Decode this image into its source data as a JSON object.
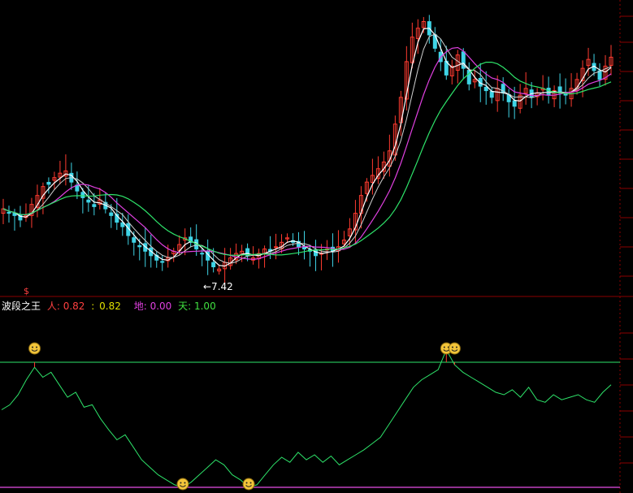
{
  "colors": {
    "background": "#000000",
    "up_candle": "#ff3b30",
    "down_candle": "#3fd4e6",
    "ma_white": "#ffffff",
    "ma_magenta": "#e040e0",
    "ma_green": "#2ee36a",
    "osc_line": "#2ee36a",
    "upper_level": "#2ee36a",
    "lower_level": "#c040c0",
    "grid": "#8b0000",
    "text_white": "#ffffff",
    "text_red": "#ff4040",
    "text_magenta": "#e040e0",
    "text_green": "#40e040"
  },
  "main_chart": {
    "low_annotation": "←7.42",
    "marker_top": "$"
  },
  "indicator": {
    "title": "波段之王",
    "ren_label": "人:",
    "ren_value": "0.82",
    "ren_sep": ":",
    "ren_value2": "0.82",
    "di_label": "地:",
    "di_value": "0.00",
    "tian_label": "天:",
    "tian_value": "1.00",
    "top_icon": "smiley-icon",
    "bottom_icon": "smiley-icon"
  },
  "chart_data": [
    {
      "type": "candlestick",
      "title": "",
      "annotations": [
        "←7.42"
      ],
      "close": [
        10.2,
        10.0,
        9.9,
        9.7,
        9.9,
        10.4,
        10.8,
        11.2,
        11.3,
        11.6,
        11.8,
        11.9,
        11.4,
        11.0,
        10.7,
        10.5,
        10.3,
        10.6,
        10.2,
        9.9,
        9.6,
        9.4,
        9.0,
        8.7,
        8.5,
        8.3,
        8.1,
        7.9,
        7.8,
        8.0,
        8.3,
        8.6,
        8.9,
        8.7,
        8.4,
        8.2,
        7.9,
        7.6,
        7.5,
        7.8,
        8.0,
        8.2,
        8.3,
        8.1,
        8.0,
        8.2,
        8.4,
        8.3,
        8.5,
        8.7,
        8.9,
        8.7,
        8.5,
        8.4,
        8.3,
        8.1,
        8.2,
        8.4,
        8.3,
        8.5,
        8.8,
        9.3,
        10.0,
        10.8,
        11.4,
        11.7,
        12.0,
        12.3,
        12.8,
        14.0,
        15.2,
        16.8,
        17.9,
        18.3,
        18.6,
        18.0,
        17.4,
        16.8,
        16.2,
        16.6,
        17.1,
        16.5,
        15.8,
        16.0,
        15.7,
        15.5,
        15.2,
        15.6,
        15.4,
        15.0,
        14.8,
        15.3,
        15.6,
        15.2,
        15.4,
        15.6,
        15.3,
        15.5,
        15.4,
        15.3,
        15.6,
        16.0,
        16.5,
        16.9,
        16.4,
        16.0,
        16.6,
        17.0
      ],
      "low_marker": 7.42
    },
    {
      "type": "line",
      "title": "波段之王",
      "series": [
        {
          "name": "人",
          "values": [
            0.62,
            0.66,
            0.74,
            0.86,
            0.96,
            0.88,
            0.92,
            0.82,
            0.72,
            0.76,
            0.64,
            0.66,
            0.55,
            0.46,
            0.38,
            0.42,
            0.32,
            0.22,
            0.16,
            0.1,
            0.06,
            0.02,
            0.0,
            0.04,
            0.1,
            0.16,
            0.22,
            0.18,
            0.1,
            0.06,
            0.0,
            0.02,
            0.1,
            0.18,
            0.24,
            0.2,
            0.28,
            0.22,
            0.26,
            0.2,
            0.25,
            0.18,
            0.22,
            0.26,
            0.3,
            0.35,
            0.4,
            0.5,
            0.6,
            0.7,
            0.8,
            0.86,
            0.9,
            0.94,
            1.1,
            0.98,
            0.92,
            0.88,
            0.84,
            0.8,
            0.76,
            0.74,
            0.78,
            0.72,
            0.8,
            0.7,
            0.68,
            0.74,
            0.7,
            0.72,
            0.74,
            0.7,
            0.68,
            0.76,
            0.82
          ]
        },
        {
          "name": "地",
          "values": [
            0.0
          ]
        },
        {
          "name": "天",
          "values": [
            1.0
          ]
        }
      ],
      "ylim": [
        0,
        1.1
      ]
    }
  ]
}
